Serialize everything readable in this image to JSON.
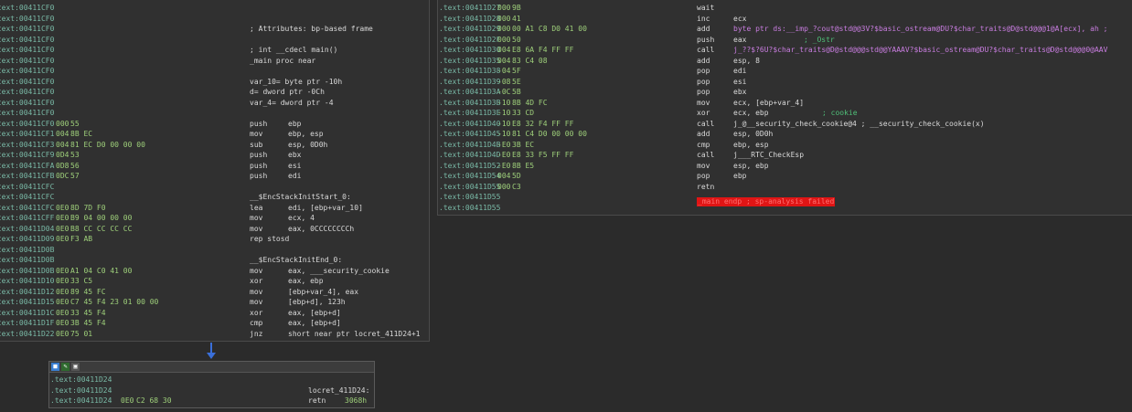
{
  "left_block": {
    "lines": [
      {
        "addr": ".text:00411CF0",
        "sp": "",
        "bytes": "",
        "mnem": "",
        "op": "",
        "cmt": ""
      },
      {
        "addr": ".text:00411CF0",
        "sp": "",
        "bytes": "",
        "mnem": "",
        "op": "",
        "cmt": ""
      },
      {
        "addr": ".text:00411CF0",
        "sp": "",
        "bytes": "",
        "mnem": "",
        "op": "",
        "cmt": "; Attributes: bp-based frame"
      },
      {
        "addr": ".text:00411CF0",
        "sp": "",
        "bytes": "",
        "mnem": "",
        "op": "",
        "cmt": ""
      },
      {
        "addr": ".text:00411CF0",
        "sp": "",
        "bytes": "",
        "mnem": "",
        "op": "",
        "cmt": "; int __cdecl main()"
      },
      {
        "addr": ".text:00411CF0",
        "sp": "",
        "bytes": "",
        "mnem": "_main proc near",
        "op": "",
        "cmt": ""
      },
      {
        "addr": ".text:00411CF0",
        "sp": "",
        "bytes": "",
        "mnem": "",
        "op": "",
        "cmt": ""
      },
      {
        "addr": ".text:00411CF0",
        "sp": "",
        "bytes": "",
        "mnem": "var_10= byte ptr -10h",
        "op": "",
        "cmt": ""
      },
      {
        "addr": ".text:00411CF0",
        "sp": "",
        "bytes": "",
        "mnem": "d= dword ptr -0Ch",
        "op": "",
        "cmt": ""
      },
      {
        "addr": ".text:00411CF0",
        "sp": "",
        "bytes": "",
        "mnem": "var_4= dword ptr -4",
        "op": "",
        "cmt": ""
      },
      {
        "addr": ".text:00411CF0",
        "sp": "",
        "bytes": "",
        "mnem": "",
        "op": "",
        "cmt": ""
      },
      {
        "addr": ".text:00411CF0",
        "sp": "000",
        "bytes": "55",
        "mnem": "push",
        "op": "ebp",
        "cmt": ""
      },
      {
        "addr": ".text:00411CF1",
        "sp": "004",
        "bytes": "8B EC",
        "mnem": "mov",
        "op": "ebp, esp",
        "cmt": ""
      },
      {
        "addr": ".text:00411CF3",
        "sp": "004",
        "bytes": "81 EC D0 00 00 00",
        "mnem": "sub",
        "op": "esp, 0D0h",
        "cmt": ""
      },
      {
        "addr": ".text:00411CF9",
        "sp": "0D4",
        "bytes": "53",
        "mnem": "push",
        "op": "ebx",
        "cmt": ""
      },
      {
        "addr": ".text:00411CFA",
        "sp": "0D8",
        "bytes": "56",
        "mnem": "push",
        "op": "esi",
        "cmt": ""
      },
      {
        "addr": ".text:00411CFB",
        "sp": "0DC",
        "bytes": "57",
        "mnem": "push",
        "op": "edi",
        "cmt": ""
      },
      {
        "addr": ".text:00411CFC",
        "sp": "",
        "bytes": "",
        "mnem": "",
        "op": "",
        "cmt": ""
      },
      {
        "addr": ".text:00411CFC",
        "sp": "",
        "bytes": "",
        "mnem": "__$EncStackInitStart_0:",
        "op": "",
        "cmt": ""
      },
      {
        "addr": ".text:00411CFC",
        "sp": "0E0",
        "bytes": "8D 7D F0",
        "mnem": "lea",
        "op": "edi, [ebp+var_10]",
        "cmt": ""
      },
      {
        "addr": ".text:00411CFF",
        "sp": "0E0",
        "bytes": "B9 04 00 00 00",
        "mnem": "mov",
        "op": "ecx, 4",
        "cmt": ""
      },
      {
        "addr": ".text:00411D04",
        "sp": "0E0",
        "bytes": "B8 CC CC CC CC",
        "mnem": "mov",
        "op": "eax, 0CCCCCCCCh",
        "cmt": ""
      },
      {
        "addr": ".text:00411D09",
        "sp": "0E0",
        "bytes": "F3 AB",
        "mnem": "rep stosd",
        "op": "",
        "cmt": ""
      },
      {
        "addr": ".text:00411D0B",
        "sp": "",
        "bytes": "",
        "mnem": "",
        "op": "",
        "cmt": ""
      },
      {
        "addr": ".text:00411D0B",
        "sp": "",
        "bytes": "",
        "mnem": "__$EncStackInitEnd_0:",
        "op": "",
        "cmt": ""
      },
      {
        "addr": ".text:00411D0B",
        "sp": "0E0",
        "bytes": "A1 04 C0 41 00",
        "mnem": "mov",
        "op": "eax, ___security_cookie",
        "cmt": ""
      },
      {
        "addr": ".text:00411D10",
        "sp": "0E0",
        "bytes": "33 C5",
        "mnem": "xor",
        "op": "eax, ebp",
        "cmt": ""
      },
      {
        "addr": ".text:00411D12",
        "sp": "0E0",
        "bytes": "89 45 FC",
        "mnem": "mov",
        "op": "[ebp+var_4], eax",
        "cmt": ""
      },
      {
        "addr": ".text:00411D15",
        "sp": "0E0",
        "bytes": "C7 45 F4 23 01 00 00",
        "mnem": "mov",
        "op": "[ebp+d], 123h",
        "cmt": ""
      },
      {
        "addr": ".text:00411D1C",
        "sp": "0E0",
        "bytes": "33 45 F4",
        "mnem": "xor",
        "op": "eax, [ebp+d]",
        "cmt": ""
      },
      {
        "addr": ".text:00411D1F",
        "sp": "0E0",
        "bytes": "3B 45 F4",
        "mnem": "cmp",
        "op": "eax, [ebp+d]",
        "cmt": ""
      },
      {
        "addr": ".text:00411D22",
        "sp": "0E0",
        "bytes": "75 01",
        "mnem": "jnz",
        "op": "short near ptr locret_411D24+1",
        "cmt": ""
      }
    ]
  },
  "right_block": {
    "lines": [
      {
        "addr": ".text:00411D27",
        "sp": "000",
        "bytes": "9B",
        "mnem": "wait",
        "op": "",
        "cmt": ""
      },
      {
        "addr": ".text:00411D28",
        "sp": "000",
        "bytes": "41",
        "mnem": "inc",
        "op": "ecx",
        "cmt": ""
      },
      {
        "addr": ".text:00411D29",
        "sp": "000",
        "bytes": "00 A1 C8 D0 41 00",
        "mnem": "add",
        "op": "byte ptr ds:__imp_?cout@std@@3V?$basic_ostream@DU?$char_traits@D@std@@@1@A[ecx], ah ;",
        "cmt": ""
      },
      {
        "addr": ".text:00411D2F",
        "sp": "000",
        "bytes": "50",
        "mnem": "push",
        "op": "eax",
        "cmt": "; _Ostr"
      },
      {
        "addr": ".text:00411D30",
        "sp": "004",
        "bytes": "E8 6A F4 FF FF",
        "mnem": "call",
        "op": "j_??$?6U?$char_traits@D@std@@@std@@YAAAV?$basic_ostream@DU?$char_traits@D@std@@@0@AAV",
        "cmt": ""
      },
      {
        "addr": ".text:00411D35",
        "sp": "004",
        "bytes": "83 C4 08",
        "mnem": "add",
        "op": "esp, 8",
        "cmt": ""
      },
      {
        "addr": ".text:00411D38",
        "sp": "-04",
        "bytes": "5F",
        "mnem": "pop",
        "op": "edi",
        "cmt": ""
      },
      {
        "addr": ".text:00411D39",
        "sp": "-08",
        "bytes": "5E",
        "mnem": "pop",
        "op": "esi",
        "cmt": ""
      },
      {
        "addr": ".text:00411D3A",
        "sp": "-0C",
        "bytes": "5B",
        "mnem": "pop",
        "op": "ebx",
        "cmt": ""
      },
      {
        "addr": ".text:00411D3B",
        "sp": "-10",
        "bytes": "8B 4D FC",
        "mnem": "mov",
        "op": "ecx, [ebp+var_4]",
        "cmt": ""
      },
      {
        "addr": ".text:00411D3E",
        "sp": "-10",
        "bytes": "33 CD",
        "mnem": "xor",
        "op": "ecx, ebp",
        "cmt": "; cookie"
      },
      {
        "addr": ".text:00411D40",
        "sp": "-10",
        "bytes": "E8 32 F4 FF FF",
        "mnem": "call",
        "op": "j_@__security_check_cookie@4 ; __security_check_cookie(x)",
        "cmt": ""
      },
      {
        "addr": ".text:00411D45",
        "sp": "-10",
        "bytes": "81 C4 D0 00 00 00",
        "mnem": "add",
        "op": "esp, 0D0h",
        "cmt": ""
      },
      {
        "addr": ".text:00411D4B",
        "sp": "-E0",
        "bytes": "3B EC",
        "mnem": "cmp",
        "op": "ebp, esp",
        "cmt": ""
      },
      {
        "addr": ".text:00411D4D",
        "sp": "-E0",
        "bytes": "E8 33 F5 FF FF",
        "mnem": "call",
        "op": "j___RTC_CheckEsp",
        "cmt": ""
      },
      {
        "addr": ".text:00411D52",
        "sp": "-E0",
        "bytes": "8B E5",
        "mnem": "mov",
        "op": "esp, ebp",
        "cmt": ""
      },
      {
        "addr": ".text:00411D54",
        "sp": "004",
        "bytes": "5D",
        "mnem": "pop",
        "op": "ebp",
        "cmt": ""
      },
      {
        "addr": ".text:00411D55",
        "sp": "000",
        "bytes": "C3",
        "mnem": "retn",
        "op": "",
        "cmt": ""
      },
      {
        "addr": ".text:00411D55",
        "sp": "",
        "bytes": "",
        "mnem": "",
        "op": "",
        "cmt": ""
      },
      {
        "addr": ".text:00411D55",
        "sp": "",
        "bytes": "",
        "mnem": "",
        "op": "",
        "cmt": ""
      }
    ],
    "endp_text": "_main endp ; sp-analysis failed"
  },
  "bottom_block": {
    "lines": [
      {
        "addr": ".text:00411D24",
        "sp": "",
        "bytes": "",
        "mnem": "",
        "op": ""
      },
      {
        "addr": ".text:00411D24",
        "sp": "",
        "bytes": "",
        "mnem": "locret_411D24:",
        "op": ""
      },
      {
        "addr": ".text:00411D24",
        "sp": "0E0",
        "bytes": "C2 68 30",
        "mnem": "retn",
        "op": "3068h"
      }
    ]
  },
  "colors": {
    "address": "#79b9a6",
    "bytes": "#9ecf7a",
    "comment": "#4fbf78",
    "error_bg": "#e01515",
    "flow_arrow": "#3a6fd9"
  }
}
